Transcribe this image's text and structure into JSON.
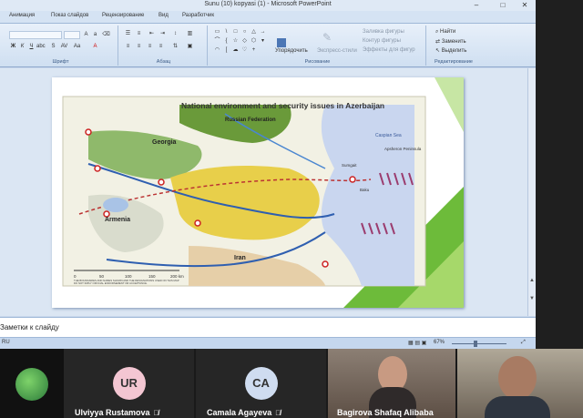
{
  "window": {
    "title": "Sunu (10) kopyasi (1) - Microsoft PowerPoint",
    "controls": [
      "–",
      "□",
      "✕"
    ]
  },
  "tabs": [
    "Анимация",
    "Показ слайдов",
    "Рецензирование",
    "Вид",
    "Разработчик"
  ],
  "ribbon": {
    "font_group": "Шрифт",
    "paragraph_group": "Абзац",
    "drawing_group": "Рисование",
    "editing_group": "Редактирование",
    "arrange_label": "Упорядочить",
    "quick_styles_label": "Экспресс-стили",
    "shape_fill": "Заливка фигуры",
    "shape_outline": "Контур фигуры",
    "shape_effects": "Эффекты для фигур",
    "find": "Найти",
    "replace": "Заменить",
    "select": "Выделить"
  },
  "slide": {
    "map_title": "National environment and security issues in Azerbaijan",
    "labels": {
      "russian_federation": "Russian Federation",
      "georgia": "Georgia",
      "armenia": "Armenia",
      "iran": "Iran",
      "caspian_sea": "Caspian Sea",
      "apsheron": "Apsheron Peninsula",
      "sumgait": "Sumgait",
      "baku": "Baku"
    },
    "scale_ticks": [
      "0",
      "50",
      "100",
      "150",
      "200 km"
    ],
    "footnote": "THE BOUNDARIES AND NAMES SHOWN AND THE DESIGNATIONS USED ON THIS MAP DO NOT IMPLY OFFICIAL ENDORSEMENT OR ACCEPTANCE."
  },
  "notes": {
    "placeholder": "Заметки к слайду"
  },
  "status": {
    "left": "RU",
    "zoom": "67%"
  },
  "participants": [
    {
      "initials": "",
      "name": "",
      "avatar_color": "#1f2a1f"
    },
    {
      "initials": "UR",
      "name": "Ulviyya Rustamova",
      "avatar_color": "#f3c6d2"
    },
    {
      "initials": "CA",
      "name": "Camala Agayeva",
      "avatar_color": "#cfdcf0"
    },
    {
      "initials": "",
      "name": "Bagirova Shafaq Alibaba",
      "avatar_color": "#6b5a4a"
    },
    {
      "initials": "",
      "name": "",
      "avatar_color": "#8a7a68"
    }
  ],
  "colors": {
    "accent_green": "#6dbb3a",
    "ribbon_blue": "#cfdff1",
    "gallery_bg": "#1a1a1a"
  }
}
